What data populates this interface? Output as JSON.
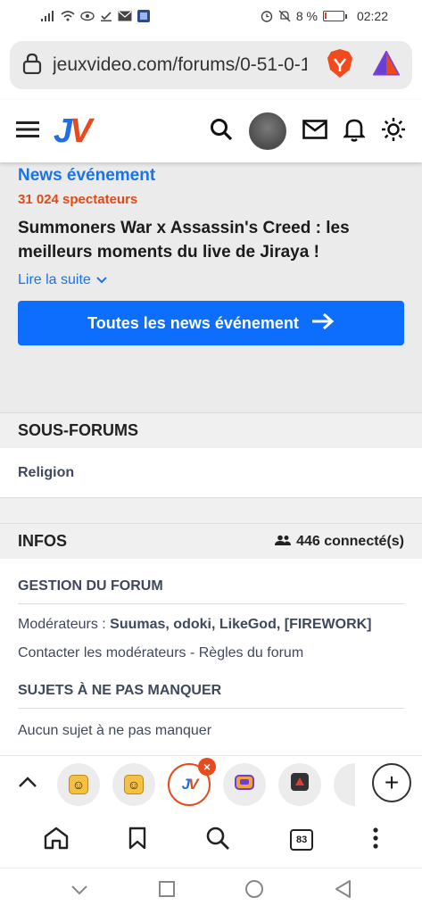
{
  "status_bar": {
    "battery_text": "8 %",
    "time": "02:22",
    "battery_level": 0.08,
    "battery_color": "#e23b2f"
  },
  "browser": {
    "url": "jeuxvideo.com/forums/0-51-0-1",
    "icons": [
      "lock-icon",
      "brave-lion-icon",
      "rewards-triangle-icon"
    ]
  },
  "header": {
    "logo_j": "J",
    "logo_v": "V",
    "icons": [
      "menu-icon",
      "search-icon",
      "avatar",
      "mail-icon",
      "bell-icon",
      "theme-sun-icon"
    ]
  },
  "news": {
    "category": "News événement",
    "viewers": "31 024 spectateurs",
    "title": "Summoners War x Assassin's Creed : les meilleurs moments du live de Jiraya !",
    "read_more": "Lire la suite",
    "all_button": "Toutes les news événement",
    "accent": "#0d6efd",
    "viewer_color": "#e14a14"
  },
  "subforums": {
    "heading": "SOUS-FORUMS",
    "items": [
      "Religion"
    ]
  },
  "infos": {
    "heading": "INFOS",
    "connected": "446 connecté(s)",
    "management_heading": "GESTION DU FORUM",
    "moderators_label": "Modérateurs : ",
    "moderators": "Suumas, odoki, LikeGod, [FIREWORK]",
    "contact": "Contacter les modérateurs",
    "separator": " - ",
    "rules": "Règles du forum",
    "must_see_heading": "SUJETS À NE PAS MANQUER",
    "must_see_none": "Aucun sujet à ne pas manquer"
  },
  "tabs": {
    "items": [
      {
        "icon": "emoji-tab-icon"
      },
      {
        "icon": "emoji-tab-icon"
      },
      {
        "icon": "jv-tab-icon",
        "active": true
      },
      {
        "icon": "game-tab-icon"
      },
      {
        "icon": "red-app-tab-icon"
      }
    ],
    "close_glyph": "×",
    "add_glyph": "+"
  },
  "toolbar": {
    "tab_count": "83"
  }
}
